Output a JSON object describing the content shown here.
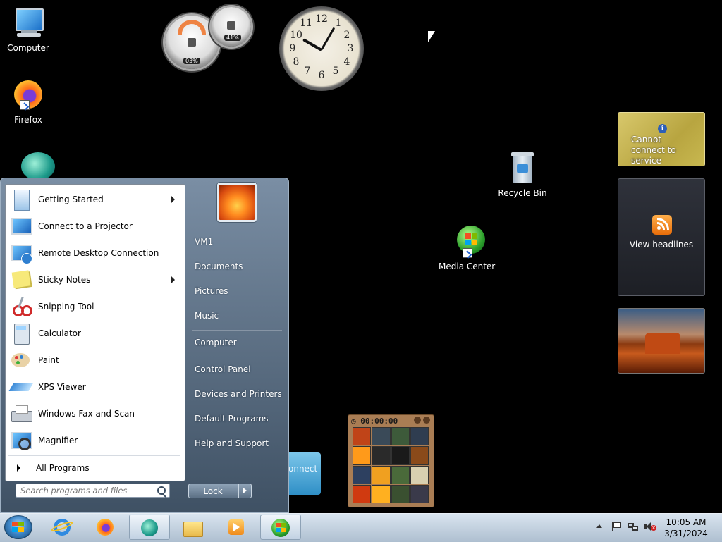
{
  "desktop": {
    "icons": [
      {
        "label": "Computer",
        "icon": "computer-icon"
      },
      {
        "label": "Firefox",
        "icon": "firefox-icon"
      },
      {
        "label": "Recycle Bin",
        "icon": "recycle-bin-icon"
      },
      {
        "label": "Media Center",
        "icon": "media-center-icon"
      }
    ]
  },
  "gadgets": {
    "cpu_meter": {
      "cpu": "03%",
      "memory": "41%"
    },
    "clock": {
      "numbers": [
        "12",
        "1",
        "2",
        "3",
        "4",
        "5",
        "6",
        "7",
        "8",
        "9",
        "10",
        "11"
      ]
    },
    "weather": {
      "message": "Cannot connect to service"
    },
    "feeds": {
      "label": "View headlines"
    },
    "puzzle": {
      "timer": "00:00:00"
    },
    "connect_label": "onnect"
  },
  "start_menu": {
    "programs": [
      {
        "label": "Getting Started",
        "submenu": true
      },
      {
        "label": "Connect to a Projector",
        "submenu": false
      },
      {
        "label": "Remote Desktop Connection",
        "submenu": false
      },
      {
        "label": "Sticky Notes",
        "submenu": true
      },
      {
        "label": "Snipping Tool",
        "submenu": false
      },
      {
        "label": "Calculator",
        "submenu": false
      },
      {
        "label": "Paint",
        "submenu": false
      },
      {
        "label": "XPS Viewer",
        "submenu": false
      },
      {
        "label": "Windows Fax and Scan",
        "submenu": false
      },
      {
        "label": "Magnifier",
        "submenu": false
      }
    ],
    "all_programs": "All Programs",
    "search_placeholder": "Search programs and files",
    "right": {
      "user": "VM1",
      "documents": "Documents",
      "pictures": "Pictures",
      "music": "Music",
      "computer": "Computer",
      "control_panel": "Control Panel",
      "devices": "Devices and Printers",
      "default_programs": "Default Programs",
      "help": "Help and Support"
    },
    "lock_label": "Lock"
  },
  "taskbar": {
    "time": "10:05 AM",
    "date": "3/31/2024"
  }
}
